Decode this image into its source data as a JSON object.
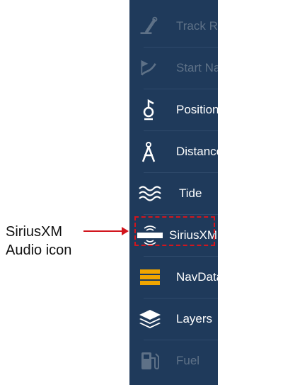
{
  "menu": {
    "items": [
      {
        "label": "Track Recording",
        "icon": "track-recording-icon",
        "disabled": true
      },
      {
        "label": "Start Nav",
        "icon": "start-nav-icon",
        "disabled": true
      },
      {
        "label": "Position Entry",
        "icon": "position-entry-icon",
        "disabled": false
      },
      {
        "label": "Distance",
        "icon": "distance-icon",
        "disabled": false
      },
      {
        "label": "Tide",
        "icon": "tide-icon",
        "disabled": false
      },
      {
        "label": "SiriusXM Audio",
        "icon": "siriusxm-audio-icon",
        "disabled": false
      },
      {
        "label": "NavData",
        "icon": "navdata-icon",
        "disabled": false
      },
      {
        "label": "Layers",
        "icon": "layers-icon",
        "disabled": false
      },
      {
        "label": "Fuel",
        "icon": "fuel-icon",
        "disabled": true
      }
    ]
  },
  "callout": {
    "line1": "SiriusXM",
    "line2": "Audio icon"
  },
  "colors": {
    "menu_bg": "#1f3a5b",
    "enabled_text": "#ffffff",
    "disabled_text": "#5e7187",
    "highlight": "#d2151d",
    "navdata_icon": "#f0a500"
  }
}
